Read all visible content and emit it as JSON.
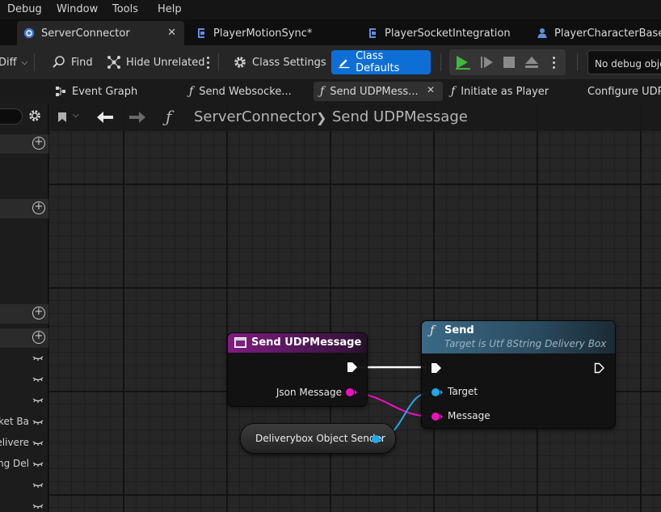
{
  "menu": [
    "Debug",
    "Window",
    "Tools",
    "Help"
  ],
  "doc_tabs": [
    {
      "label": "ServerConnector",
      "active": true,
      "closable": true
    },
    {
      "label": "PlayerMotionSync*"
    },
    {
      "label": "PlayerSocketIntegration"
    },
    {
      "label": "PlayerCharacterBase"
    }
  ],
  "toolbar": {
    "diff_label": "Diff",
    "find_label": "Find",
    "hide_unrelated_label": "Hide Unrelated",
    "class_settings_label": "Class Settings",
    "class_defaults_label": "Class Defaults",
    "debug_object_label": "No debug object selected"
  },
  "graph_tabs": [
    {
      "label": "Event Graph",
      "icon": "event-graph-icon"
    },
    {
      "label": "Send Websocke...",
      "icon": "function-icon"
    },
    {
      "label": "Send UDPMess...",
      "icon": "function-icon",
      "active": true
    },
    {
      "label": "Initiate as Player",
      "icon": "function-icon"
    },
    {
      "label": "Configure UDP",
      "icon": "event-graph-icon"
    }
  ],
  "breadcrumb": {
    "blueprint": "ServerConnector",
    "function": "Send UDPMessage"
  },
  "left_panel": {
    "rows": [
      "",
      "",
      "",
      "ket Ba",
      "elivere",
      "ng Del",
      "",
      ""
    ]
  },
  "nodes": {
    "entry": {
      "title": "Send UDPMessage",
      "pin": "Json Message"
    },
    "send": {
      "title": "Send",
      "subtitle": "Target is Utf 8String Delivery Box",
      "pins": [
        "Target",
        "Message"
      ]
    },
    "variable": {
      "label": "Deliverybox Object Sender"
    }
  },
  "colors": {
    "accent_blue": "#0d6ed6",
    "string_pin": "#f00fc0",
    "object_pin": "#1fa9ea",
    "entry_header": "#8a1f8a",
    "function_header": "#3a6a86",
    "play_green": "#3fb73f"
  }
}
